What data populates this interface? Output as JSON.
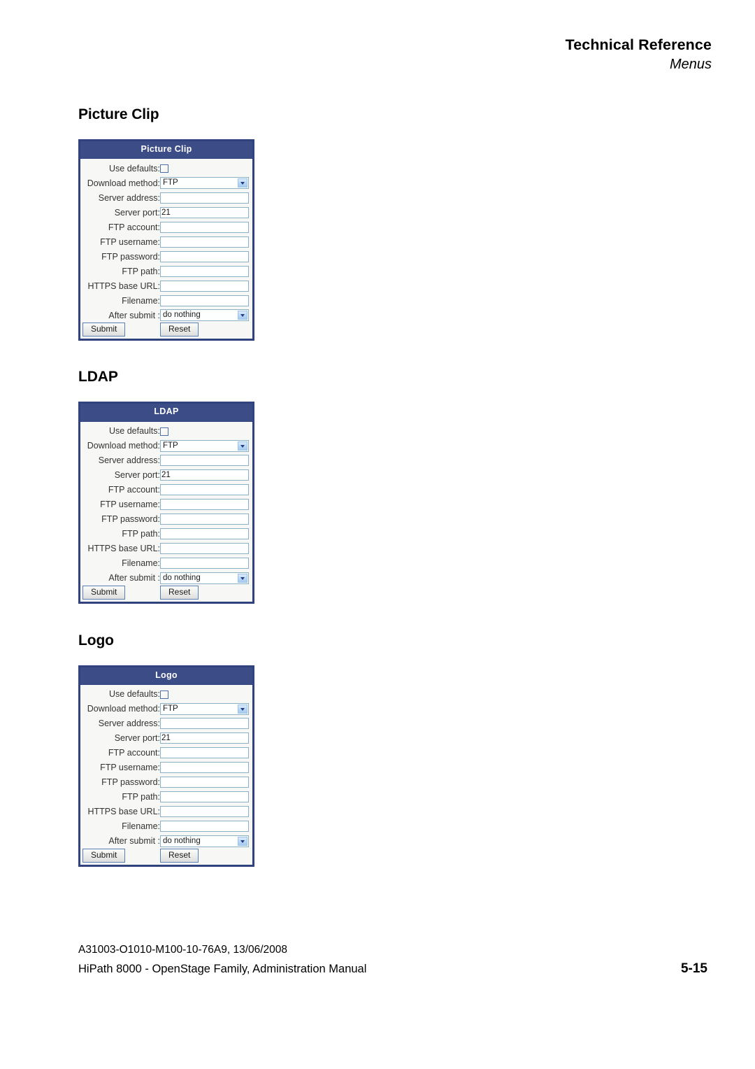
{
  "header": {
    "title": "Technical Reference",
    "subtitle": "Menus"
  },
  "sections": [
    {
      "heading": "Picture Clip",
      "panel_title": "Picture Clip"
    },
    {
      "heading": "LDAP",
      "panel_title": "LDAP"
    },
    {
      "heading": "Logo",
      "panel_title": "Logo"
    }
  ],
  "form": {
    "rows": [
      {
        "label": "Use defaults:",
        "type": "checkbox",
        "value": ""
      },
      {
        "label": "Download method:",
        "type": "select",
        "value": "FTP"
      },
      {
        "label": "Server address:",
        "type": "text",
        "value": ""
      },
      {
        "label": "Server port:",
        "type": "text",
        "value": "21"
      },
      {
        "label": "FTP account:",
        "type": "text",
        "value": ""
      },
      {
        "label": "FTP username:",
        "type": "text",
        "value": ""
      },
      {
        "label": "FTP password:",
        "type": "text",
        "value": ""
      },
      {
        "label": "FTP path:",
        "type": "text",
        "value": ""
      },
      {
        "label": "HTTPS base URL:",
        "type": "text",
        "value": ""
      },
      {
        "label": "Filename:",
        "type": "text",
        "value": ""
      },
      {
        "label": "After submit :",
        "type": "select",
        "value": "do nothing"
      }
    ],
    "submit_label": "Submit",
    "reset_label": "Reset",
    "dropdown_icon": "chevron-down-icon",
    "checkbox_checked": false
  },
  "footer": {
    "document_id": "A31003-O1010-M100-10-76A9, 13/06/2008",
    "manual_title": "HiPath 8000 - OpenStage Family, Administration Manual",
    "page_number": "5-15"
  },
  "colors": {
    "panel_border": "#31437e",
    "panel_title_bg": "#3b4c86",
    "panel_title_fg": "#ffffff",
    "panel_body_bg": "#f7f7f5",
    "input_border": "#8ab0c8",
    "button_border": "#5b7fb5"
  }
}
